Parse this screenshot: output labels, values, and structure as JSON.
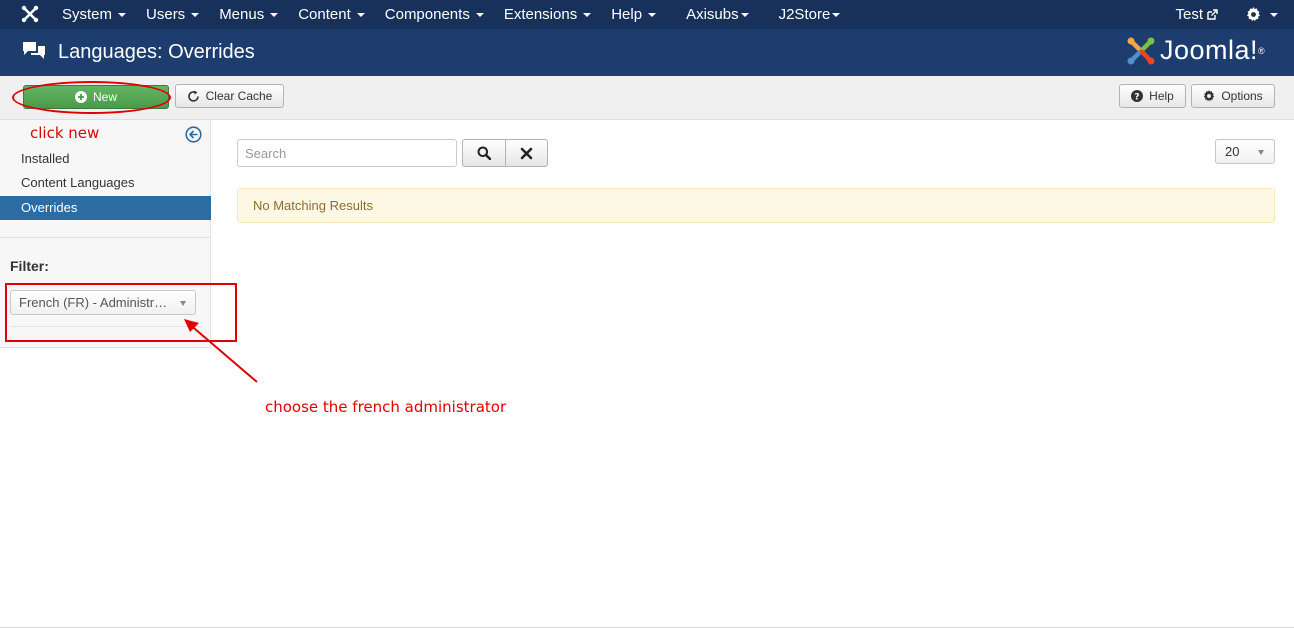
{
  "navbar": {
    "menu": [
      {
        "label": "System"
      },
      {
        "label": "Users"
      },
      {
        "label": "Menus"
      },
      {
        "label": "Content"
      },
      {
        "label": "Components"
      },
      {
        "label": "Extensions"
      },
      {
        "label": "Help"
      },
      {
        "label": "Axisubs"
      },
      {
        "label": "J2Store"
      }
    ],
    "user_label": "Test"
  },
  "header": {
    "title": "Languages: Overrides",
    "brand": "Joomla!",
    "brand_mark": "®"
  },
  "toolbar": {
    "new_label": "New",
    "clear_cache_label": "Clear Cache",
    "help_label": "Help",
    "options_label": "Options"
  },
  "sidebar": {
    "links": [
      {
        "label": "Installed"
      },
      {
        "label": "Content Languages"
      },
      {
        "label": "Overrides",
        "active": true
      }
    ],
    "filter_label": "Filter:",
    "filter_value": "French (FR) - Administrator"
  },
  "main": {
    "search_placeholder": "Search",
    "limit_value": "20",
    "alert_text": "No Matching Results"
  },
  "annotations": {
    "click_new": "click new",
    "choose_french": "choose the french administrator"
  },
  "colors": {
    "navbar": "#17315a",
    "header": "#1c3d6e",
    "active_link": "#2d6ca2",
    "new_button": "#4a9a4a",
    "annotation": "#e00000",
    "alert_bg": "#fcf8e3"
  }
}
